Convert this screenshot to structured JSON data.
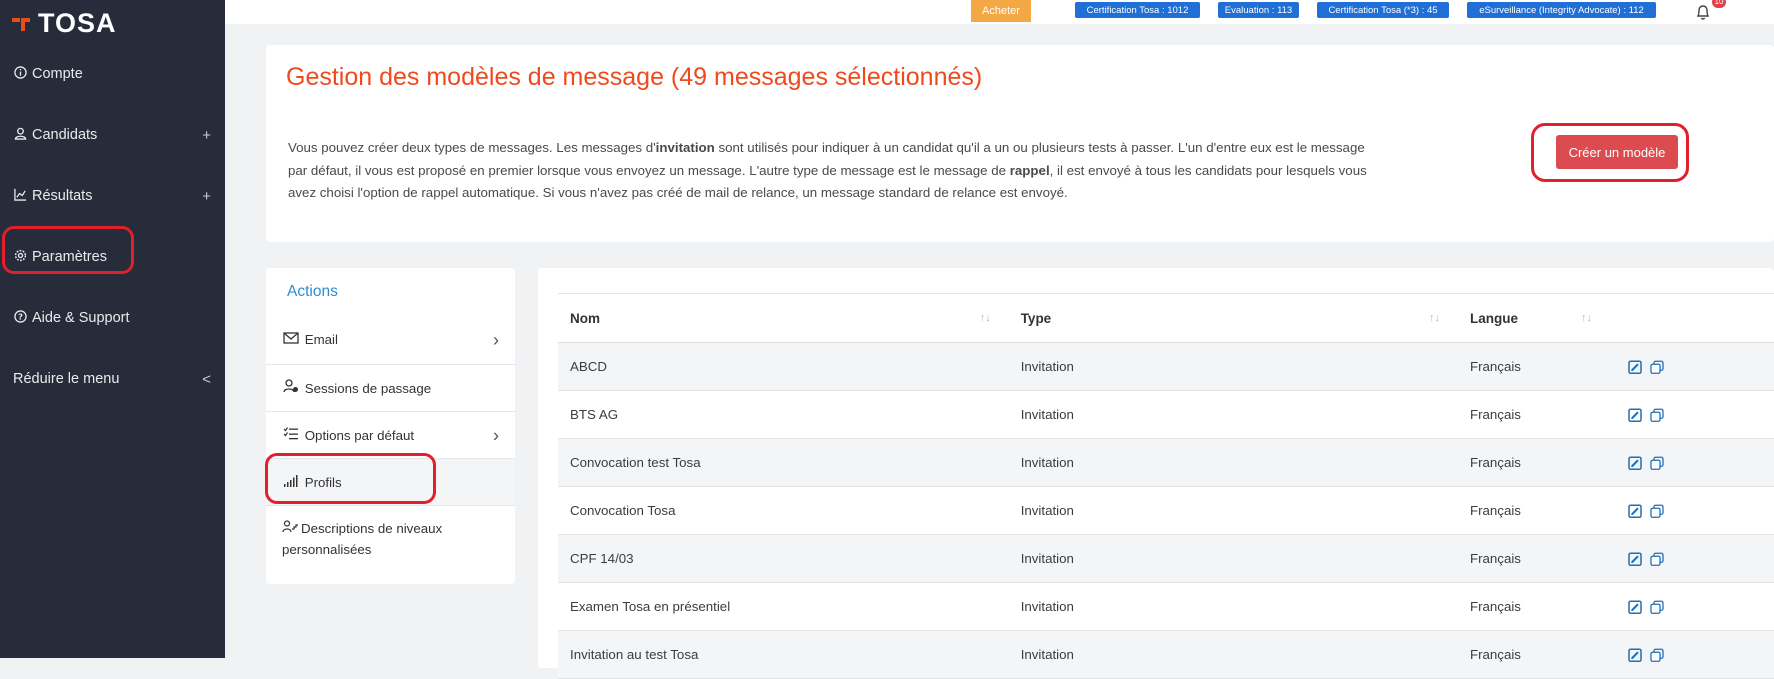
{
  "brand": {
    "name": "TOSA",
    "logo_color": "#ee4b1d"
  },
  "sidebar": {
    "items": [
      {
        "label": "Compte",
        "icon": "info-icon",
        "expandable": false
      },
      {
        "label": "Candidats",
        "icon": "user-icon",
        "expandable": true,
        "expand_symbol": "+"
      },
      {
        "label": "Résultats",
        "icon": "chart-icon",
        "expandable": true,
        "expand_symbol": "+"
      },
      {
        "label": "Paramètres",
        "icon": "gear-icon",
        "expandable": false
      },
      {
        "label": "Aide & Support",
        "icon": "help-icon",
        "expandable": false
      },
      {
        "label": "Réduire le menu",
        "icon": "",
        "expandable": true,
        "expand_symbol": "<"
      }
    ]
  },
  "topbar": {
    "buy_label": "Acheter",
    "badges": [
      "Certification Tosa : 1012",
      "Evaluation : 113",
      "Certification Tosa (*3) : 45",
      "eSurveillance (Integrity Advocate) : 112"
    ],
    "notifications_count": "10"
  },
  "header": {
    "title": "Gestion des modèles de message (49 messages sélectionnés)",
    "intro_parts": {
      "p1": "Vous pouvez créer deux types de messages. Les messages d'",
      "b1": "invitation",
      "p2": " sont utilisés pour indiquer à un candidat qu'il a un ou plusieurs tests à passer. L'un d'entre eux est le message par défaut, il vous est proposé en premier lorsque vous envoyez un message. L'autre type de message est le message de ",
      "b2": "rappel",
      "p3": ", il est envoyé à tous les candidats pour lesquels vous avez choisi l'option de rappel automatique. Si vous n'avez pas créé de mail de relance, un message standard de relance est envoyé."
    },
    "create_button_label": "Créer un modèle"
  },
  "actions": {
    "title": "Actions",
    "items": [
      {
        "label": "Email",
        "icon": "email-icon",
        "has_chevron": true
      },
      {
        "label": "Sessions de passage",
        "icon": "user-session-icon",
        "has_chevron": false
      },
      {
        "label": "Options par défaut",
        "icon": "checklist-icon",
        "has_chevron": true
      },
      {
        "label": "Profils",
        "icon": "signal-bars-icon",
        "has_chevron": false
      },
      {
        "label": "Descriptions de niveaux personnalisées",
        "icon": "level-description-icon",
        "has_chevron": false
      }
    ]
  },
  "table": {
    "columns": [
      "Nom",
      "Type",
      "Langue"
    ],
    "sort_symbol": "↑↓",
    "rows": [
      {
        "nom": "ABCD",
        "type": "Invitation",
        "langue": "Français"
      },
      {
        "nom": "BTS AG",
        "type": "Invitation",
        "langue": "Français"
      },
      {
        "nom": "Convocation test Tosa",
        "type": "Invitation",
        "langue": "Français"
      },
      {
        "nom": "Convocation Tosa",
        "type": "Invitation",
        "langue": "Français"
      },
      {
        "nom": "CPF 14/03",
        "type": "Invitation",
        "langue": "Français"
      },
      {
        "nom": "Examen Tosa en présentiel",
        "type": "Invitation",
        "langue": "Français"
      },
      {
        "nom": "Invitation au test Tosa",
        "type": "Invitation",
        "langue": "Français"
      }
    ]
  },
  "colors": {
    "sidebar_bg": "#262c39",
    "title_orange": "#ee4b1d",
    "buy_orange": "#f3a745",
    "badge_blue": "#1f6fd6",
    "create_red": "#dc4b4f",
    "actions_blue": "#2a8fd0",
    "highlight_red": "#e0202a"
  }
}
